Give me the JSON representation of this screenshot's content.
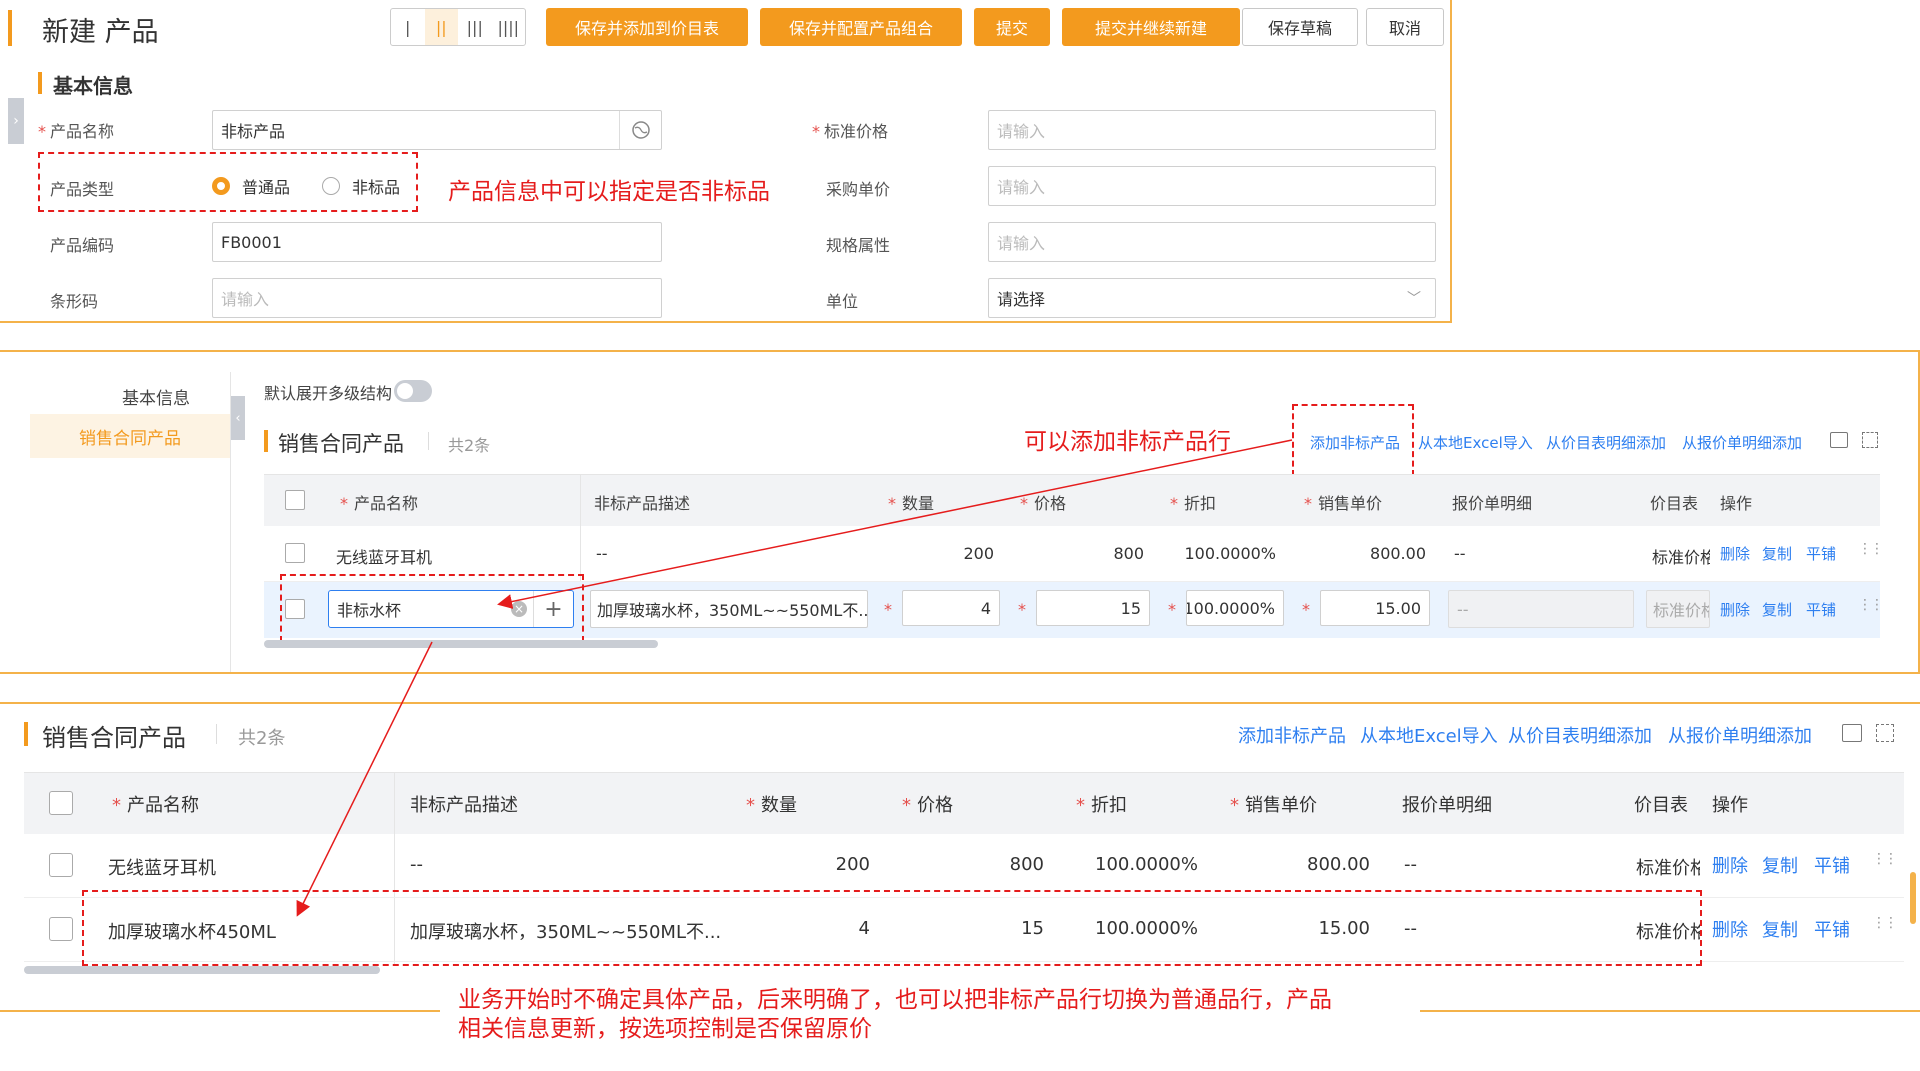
{
  "page1": {
    "title": "新建 产品",
    "layout_buttons": [
      "|",
      "||",
      "|||",
      "||||"
    ],
    "buttons": {
      "save_add": "保存并添加到价目表",
      "save_config": "保存并配置产品组合",
      "submit": "提交",
      "submit_new": "提交并继续新建",
      "save_draft": "保存草稿",
      "cancel": "取消"
    },
    "section": "基本信息",
    "fields": {
      "name_label": "产品名称",
      "name_value": "非标产品",
      "type_label": "产品类型",
      "type_opt1": "普通品",
      "type_opt2": "非标品",
      "code_label": "产品编码",
      "code_value": "FB0001",
      "barcode_label": "条形码",
      "barcode_ph": "请输入",
      "price_label": "标准价格",
      "price_ph": "请输入",
      "purchase_label": "采购单价",
      "purchase_ph": "请输入",
      "spec_label": "规格属性",
      "spec_ph": "请输入",
      "unit_label": "单位",
      "unit_value": "请选择"
    },
    "annotation": "产品信息中可以指定是否非标品"
  },
  "page2": {
    "nav": [
      "基本信息",
      "销售合同产品"
    ],
    "toggle_label": "默认展开多级结构",
    "title": "销售合同产品",
    "count": "共2条",
    "annotation": "可以添加非标产品行",
    "links": [
      "添加非标产品",
      "从本地Excel导入",
      "从价目表明细添加",
      "从报价单明细添加"
    ],
    "headers": [
      "产品名称",
      "非标产品描述",
      "数量",
      "价格",
      "折扣",
      "销售单价",
      "报价单明细",
      "价目表",
      "操作"
    ],
    "rows": [
      {
        "name": "无线蓝牙耳机",
        "desc": "--",
        "qty": "200",
        "price": "800",
        "discount": "100.0000%",
        "unit_price": "800.00",
        "quote": "--",
        "pricelist": "标准价格"
      },
      {
        "name": "非标水杯",
        "desc": "加厚玻璃水杯，350ML~~550ML不...",
        "qty": "4",
        "price": "15",
        "discount": "100.0000%",
        "unit_price": "15.00",
        "quote": "--",
        "pricelist": "标准价格"
      }
    ],
    "ops": [
      "删除",
      "复制",
      "平铺"
    ]
  },
  "page3": {
    "title": "销售合同产品",
    "count": "共2条",
    "links": [
      "添加非标产品",
      "从本地Excel导入",
      "从价目表明细添加",
      "从报价单明细添加"
    ],
    "headers": [
      "产品名称",
      "非标产品描述",
      "数量",
      "价格",
      "折扣",
      "销售单价",
      "报价单明细",
      "价目表",
      "操作"
    ],
    "rows": [
      {
        "name": "无线蓝牙耳机",
        "desc": "--",
        "qty": "200",
        "price": "800",
        "discount": "100.0000%",
        "unit_price": "800.00",
        "quote": "--",
        "pricelist": "标准价格"
      },
      {
        "name": "加厚玻璃水杯450ML",
        "desc": "加厚玻璃水杯，350ML~~550ML不...",
        "qty": "4",
        "price": "15",
        "discount": "100.0000%",
        "unit_price": "15.00",
        "quote": "--",
        "pricelist": "标准价格"
      }
    ],
    "ops": [
      "删除",
      "复制",
      "平铺"
    ],
    "annotation_line1": "业务开始时不确定具体产品，后来明确了，也可以把非标产品行切换为普通品行，产品",
    "annotation_line2": "相关信息更新，按选项控制是否保留原价"
  },
  "colors": {
    "orange": "#f39a1e",
    "red": "#e51c1c",
    "blue": "#2e7ff0"
  }
}
